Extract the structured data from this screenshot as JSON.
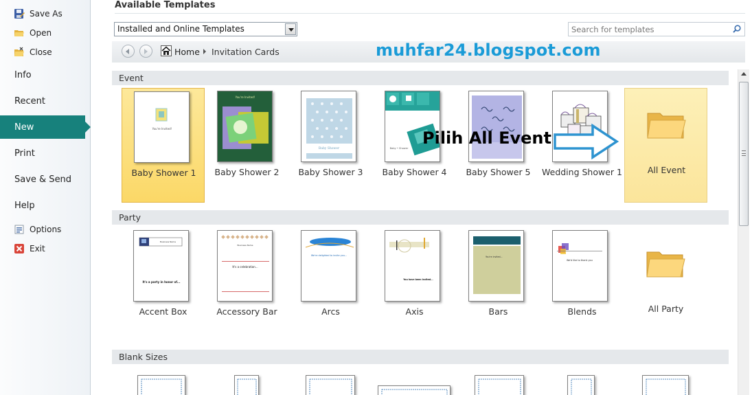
{
  "sidebar": {
    "save_as": "Save As",
    "open": "Open",
    "close": "Close",
    "info": "Info",
    "recent": "Recent",
    "new": "New",
    "print": "Print",
    "save_send": "Save & Send",
    "help": "Help",
    "options": "Options",
    "exit": "Exit"
  },
  "main": {
    "title": "Available Templates",
    "filter_value": "Installed and Online Templates",
    "search_placeholder": "Search for templates",
    "breadcrumb": {
      "home": "Home",
      "current": "Invitation Cards"
    },
    "watermark": "muhfar24.blogspot.com",
    "callout": "Pilih All Event"
  },
  "sections": {
    "event": {
      "header": "Event",
      "items": [
        "Baby Shower 1",
        "Baby Shower 2",
        "Baby Shower 3",
        "Baby Shower 4",
        "Baby Shower 5",
        "Wedding Shower 1"
      ],
      "all_label": "All Event"
    },
    "party": {
      "header": "Party",
      "items": [
        "Accent Box",
        "Accessory Bar",
        "Arcs",
        "Axis",
        "Bars",
        "Blends"
      ],
      "all_label": "All Party"
    },
    "blank": {
      "header": "Blank Sizes"
    }
  },
  "thumbnail_text": {
    "bs1": "You're Invited!",
    "bs2": "You're Invited!",
    "bs3": "Baby Shower",
    "bs4": "Baby • Shower",
    "accent_box_head": "Business Name",
    "accent_box_body": "It's a party in honor of...",
    "accessory_bar_head": "Business Name",
    "accessory_bar_body": "It's a celebration...",
    "arcs_body": "We're delighted to invite you...",
    "axis_body": "You have been invited...",
    "bars_body": "You're invited...",
    "blends_body": "We'd like to thank you"
  }
}
